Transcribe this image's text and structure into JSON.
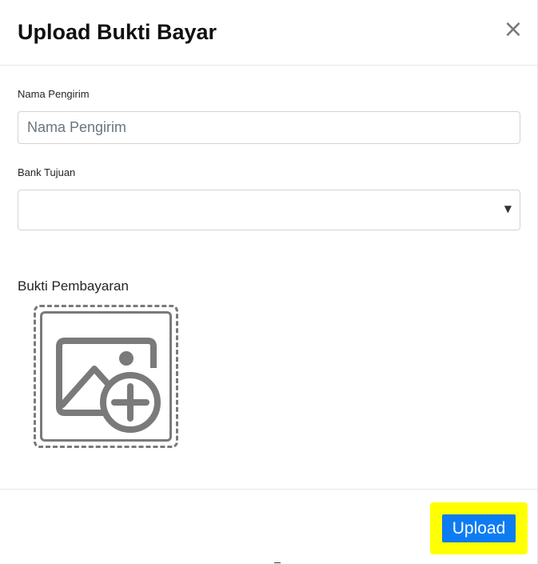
{
  "modal": {
    "title": "Upload Bukti Bayar",
    "close_glyph": "×"
  },
  "form": {
    "sender_label": "Nama Pengirim",
    "sender_placeholder": "Nama Pengirim",
    "sender_value": "",
    "bank_label": "Bank Tujuan",
    "bank_selected": "",
    "bank_arrow": "▼",
    "proof_label": "Bukti Pembayaran",
    "proof_icon": "add-image-icon"
  },
  "footer": {
    "upload_label": "Upload"
  },
  "colors": {
    "primary_button": "#0d7cf2",
    "highlight": "#ffff00",
    "icon_gray": "#7a7a7a"
  }
}
